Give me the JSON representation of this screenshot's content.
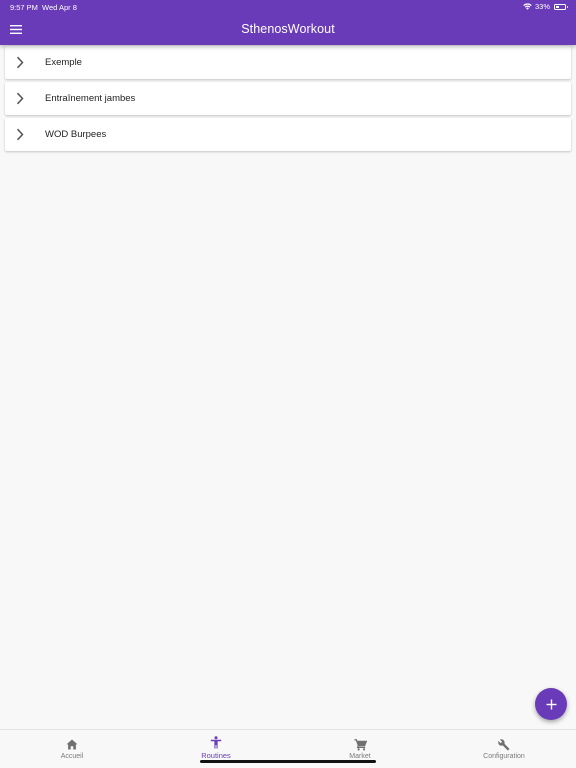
{
  "status_bar": {
    "time": "9:57 PM",
    "date": "Wed Apr 8",
    "battery": "33%",
    "battery_level": 0.33,
    "wifi_icon": "wifi-icon",
    "battery_icon": "battery-icon"
  },
  "app_bar": {
    "title": "SthenosWorkout",
    "menu_icon": "menu-icon",
    "background": "#6a3bb8"
  },
  "routines": [
    {
      "label": "Exemple",
      "icon": "chevron-right-icon"
    },
    {
      "label": "Entraînement jambes",
      "icon": "chevron-right-icon"
    },
    {
      "label": "WOD Burpees",
      "icon": "chevron-right-icon"
    }
  ],
  "fab": {
    "icon": "plus-icon",
    "color": "#6a3bb8"
  },
  "bottom_nav": {
    "items": [
      {
        "label": "Accueil",
        "icon": "home-icon",
        "active": false
      },
      {
        "label": "Routines",
        "icon": "person-icon",
        "active": true
      },
      {
        "label": "Market",
        "icon": "cart-icon",
        "active": false
      },
      {
        "label": "Configuration",
        "icon": "wrench-icon",
        "active": false
      }
    ],
    "active_color": "#6a3bb8",
    "inactive_color": "#7a7a7a"
  }
}
